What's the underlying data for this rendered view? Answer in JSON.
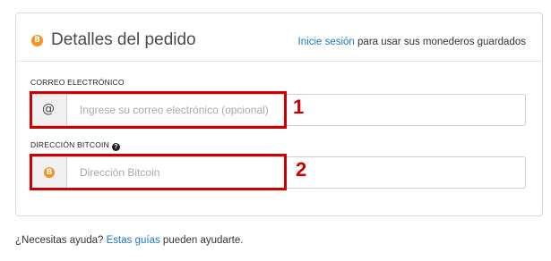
{
  "header": {
    "title": "Detalles del pedido",
    "signin_link": "Inicie sesión",
    "signin_suffix": " para usar sus monederos guardados",
    "icon": "bitcoin-icon"
  },
  "email": {
    "label": "CORREO ELECTRÓNICO",
    "placeholder": "Ingrese su correo electrónico (opcional)",
    "value": "",
    "addon_icon": "at-sign-icon",
    "addon_glyph": "@"
  },
  "bitcoin": {
    "label": "DIRECCIÓN BITCOIN",
    "help_icon": "question-circle-icon",
    "help_glyph": "?",
    "placeholder": "Dirección Bitcoin",
    "value": "",
    "addon_icon": "bitcoin-icon"
  },
  "btc_glyph": "B",
  "annotations": {
    "callout_1": "1",
    "callout_2": "2",
    "highlight_color": "#cc0000"
  },
  "footer": {
    "prefix": "¿Necesitas ayuda? ",
    "link": "Estas guías",
    "suffix": " pueden ayudarte."
  },
  "colors": {
    "link": "#1a77c9",
    "bitcoin_orange": "#f7931a",
    "border": "#d9d9d9"
  }
}
